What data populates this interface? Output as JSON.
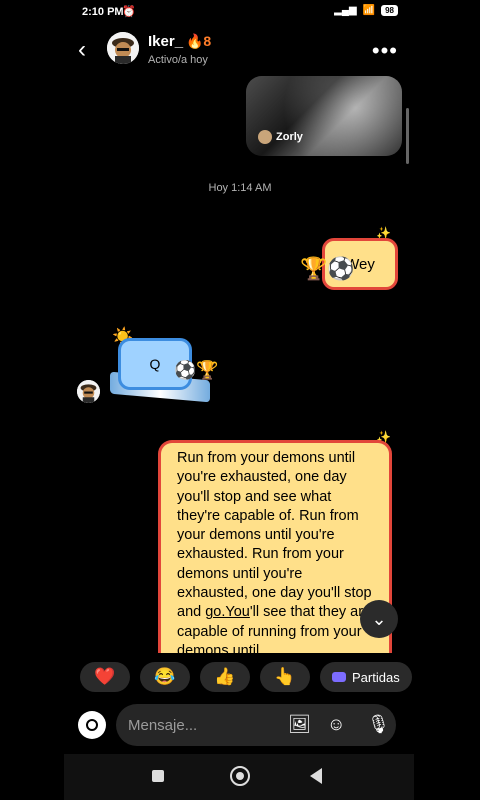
{
  "statusbar": {
    "time": "2:10 PM",
    "battery": "98"
  },
  "header": {
    "back_icon": "‹",
    "name": "Iker_",
    "streak": "🔥8",
    "status": "Activo/a hoy",
    "menu_icon": "•••"
  },
  "media": {
    "label": "Zorly"
  },
  "datestamp": "Hoy 1:14 AM",
  "messages": {
    "wey": "Wey",
    "q": "Q",
    "long_part1": "Run from your demons until you're exhausted, one day you'll stop and see what they're capable of. Run from your demons until you're exhausted. Run from your demons until you're exhausted, one day you'll stop and ",
    "long_underlined": "go.You",
    "long_part2": "'ll see that they are capable of running from your demons until"
  },
  "reactions": [
    {
      "emoji": "❤️"
    },
    {
      "emoji": "😂"
    },
    {
      "emoji": "👍"
    },
    {
      "emoji": "👆"
    }
  ],
  "partidas_label": "Partidas",
  "composer": {
    "placeholder": "Mensaje..."
  },
  "colors": {
    "bubble_fill": "#ffe08a",
    "bubble_border": "#e2463a",
    "q_fill": "#9fd2ff",
    "background": "#000000"
  }
}
